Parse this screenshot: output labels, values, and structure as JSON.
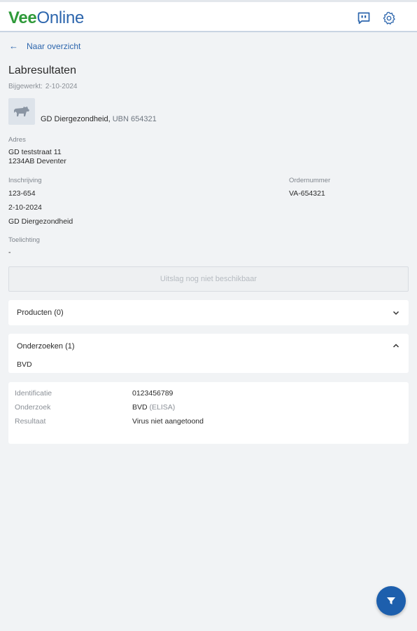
{
  "app": {
    "logo_part1": "Vee",
    "logo_part2": "Online"
  },
  "icons": {
    "chat": "chat-icon",
    "settings": "gear-icon",
    "back": "arrow-left-icon",
    "avatar": "cow-icon",
    "filter": "filter-icon",
    "chevron_down": "chevron-down-icon",
    "chevron_up": "chevron-up-icon"
  },
  "colors": {
    "brand_green": "#2f9a3a",
    "brand_blue": "#2d66ad",
    "fab": "#1d5fad"
  },
  "nav": {
    "back_label": "Naar overzicht"
  },
  "page": {
    "title": "Labresultaten",
    "updated_label": "Bijgewerkt:",
    "updated_value": "2-10-2024"
  },
  "lab": {
    "name": "GD Diergezondheid,",
    "ubn": "UBN 654321"
  },
  "address": {
    "label": "Adres",
    "line1": "GD teststraat 11",
    "line2": "1234AB Deventer"
  },
  "registration": {
    "label": "Inschrijving",
    "number": "123-654",
    "date": "2-10-2024",
    "organization": "GD Diergezondheid"
  },
  "order": {
    "label": "Ordernummer",
    "value": "VA-654321"
  },
  "notes": {
    "label": "Toelichting",
    "value": "-"
  },
  "result_button": {
    "label": "Uitslag nog niet beschikbaar"
  },
  "products": {
    "label": "Producten (0)"
  },
  "studies": {
    "label": "Onderzoeken (1)",
    "item": "BVD"
  },
  "detail": {
    "identification_label": "Identificatie",
    "identification_value": "0123456789",
    "study_label": "Onderzoek",
    "study_value": "BVD",
    "study_method": "(ELISA)",
    "result_label": "Resultaat",
    "result_value": "Virus niet aangetoond"
  }
}
